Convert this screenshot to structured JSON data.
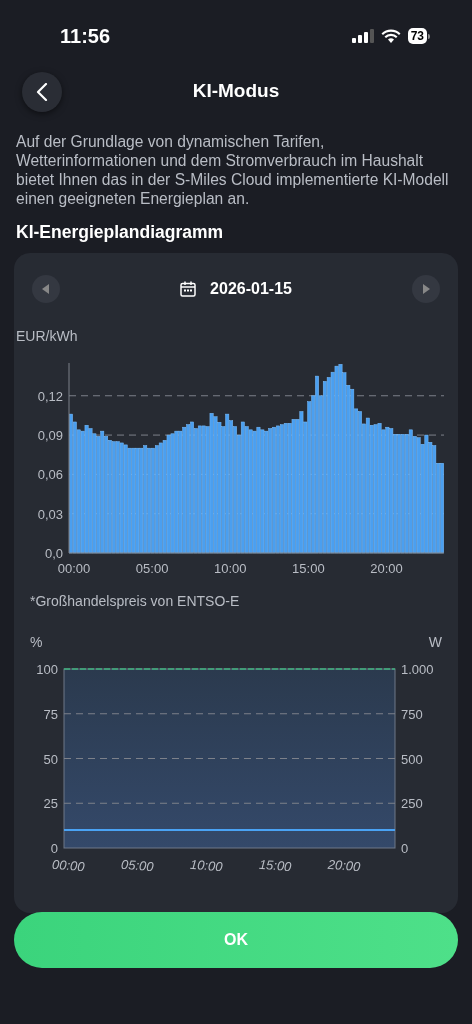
{
  "status_bar": {
    "time": "11:56",
    "battery": "73"
  },
  "header": {
    "title": "KI-Modus"
  },
  "description": "Auf der Grundlage von dynamischen Tarifen, Wetterinformationen und dem Stromverbrauch im Haushalt bietet Ihnen das in der S-Miles Cloud implementierte KI-Modell einen geeigneten Energieplan an.",
  "section_title": "KI-Energieplandiagramm",
  "date_nav": {
    "date": "2026-01-15"
  },
  "price_chart": {
    "chart_data": {
      "type": "bar",
      "ylabel": "EUR/kWh",
      "x": [
        0,
        0.25,
        0.5,
        0.75,
        1,
        1.25,
        1.5,
        1.75,
        2,
        2.25,
        2.5,
        2.75,
        3,
        3.25,
        3.5,
        3.75,
        4,
        4.25,
        4.5,
        4.75,
        5,
        5.25,
        5.5,
        5.75,
        6,
        6.25,
        6.5,
        6.75,
        7,
        7.25,
        7.5,
        7.75,
        8,
        8.25,
        8.5,
        8.75,
        9,
        9.25,
        9.5,
        9.75,
        10,
        10.25,
        10.5,
        10.75,
        11,
        11.25,
        11.5,
        11.75,
        12,
        12.25,
        12.5,
        12.75,
        13,
        13.25,
        13.5,
        13.75,
        14,
        14.25,
        14.5,
        14.75,
        15,
        15.25,
        15.5,
        15.75,
        16,
        16.25,
        16.5,
        16.75,
        17,
        17.25,
        17.5,
        17.75,
        18,
        18.25,
        18.5,
        18.75,
        19,
        19.25,
        19.5,
        19.75,
        20,
        20.25,
        20.5,
        20.75,
        21,
        21.25,
        21.5,
        21.75,
        22,
        22.25,
        22.5,
        22.75,
        23,
        23.25,
        23.5,
        23.75
      ],
      "series": [
        {
          "color": "#4a9ff0",
          "values": [
            0.106,
            0.1,
            0.094,
            0.093,
            0.0975,
            0.095,
            0.091,
            0.089,
            0.093,
            0.089,
            0.086,
            0.085,
            0.085,
            0.084,
            0.0825,
            0.08,
            0.08,
            0.08,
            0.08,
            0.082,
            0.08,
            0.08,
            0.082,
            0.084,
            0.086,
            0.09,
            0.091,
            0.093,
            0.093,
            0.096,
            0.098,
            0.1,
            0.095,
            0.097,
            0.097,
            0.0965,
            0.1066,
            0.104,
            0.0998,
            0.0965,
            0.106,
            0.101,
            0.0965,
            0.09,
            0.1,
            0.0965,
            0.094,
            0.093,
            0.096,
            0.094,
            0.093,
            0.095,
            0.096,
            0.097,
            0.098,
            0.099,
            0.099,
            0.102,
            0.102,
            0.108,
            0.1,
            0.1155,
            0.12,
            0.135,
            0.12,
            0.131,
            0.134,
            0.138,
            0.1426,
            0.144,
            0.1376,
            0.128,
            0.125,
            0.11,
            0.108,
            0.0985,
            0.103,
            0.0975,
            0.098,
            0.099,
            0.094,
            0.096,
            0.095,
            0.0906,
            0.0906,
            0.0906,
            0.0906,
            0.094,
            0.089,
            0.088,
            0.083,
            0.09,
            0.0845,
            0.082,
            0.0685,
            0.0685
          ]
        }
      ],
      "xlim": [
        0,
        24
      ],
      "ylim": [
        0,
        0.145
      ],
      "xticks": [
        {
          "value": 0,
          "label": "00:00"
        },
        {
          "value": 5,
          "label": "05:00"
        },
        {
          "value": 10,
          "label": "10:00"
        },
        {
          "value": 15,
          "label": "15:00"
        },
        {
          "value": 20,
          "label": "20:00"
        }
      ],
      "grid": true,
      "yticks": [
        {
          "value": 0,
          "label": "0,0"
        },
        {
          "value": 0.03,
          "label": "0,03"
        },
        {
          "value": 0.06,
          "label": "0,06"
        },
        {
          "value": 0.09,
          "label": "0,09"
        },
        {
          "value": 0.12,
          "label": "0,12"
        }
      ]
    }
  },
  "price_note": "*Großhandelspreis von ENTSO-E",
  "plan_chart": {
    "chart_data": {
      "type": "line",
      "ylabel": "%",
      "y2label": "W",
      "x": [
        0,
        24
      ],
      "series": [
        {
          "color": "#4aa3f5",
          "line_style": "solid",
          "values": [
            10,
            10
          ]
        },
        {
          "color": "#3fb37f",
          "line_style": "dashed",
          "values": [
            100,
            100
          ]
        }
      ],
      "xlim": [
        0,
        24
      ],
      "ylim": [
        0,
        100
      ],
      "xticks": [
        {
          "value": 0,
          "label": "00:00"
        },
        {
          "value": 5,
          "label": "05:00"
        },
        {
          "value": 10,
          "label": "10:00"
        },
        {
          "value": 15,
          "label": "15:00"
        },
        {
          "value": 20,
          "label": "20:00"
        }
      ],
      "grid": true,
      "yticks": [
        0,
        25,
        50,
        75,
        100
      ],
      "y2lim": [
        0,
        1000
      ],
      "y2ticks": [
        0,
        250,
        500,
        750,
        {
          "value": 1000,
          "label": "1.000"
        }
      ]
    }
  },
  "ok_button": "OK"
}
